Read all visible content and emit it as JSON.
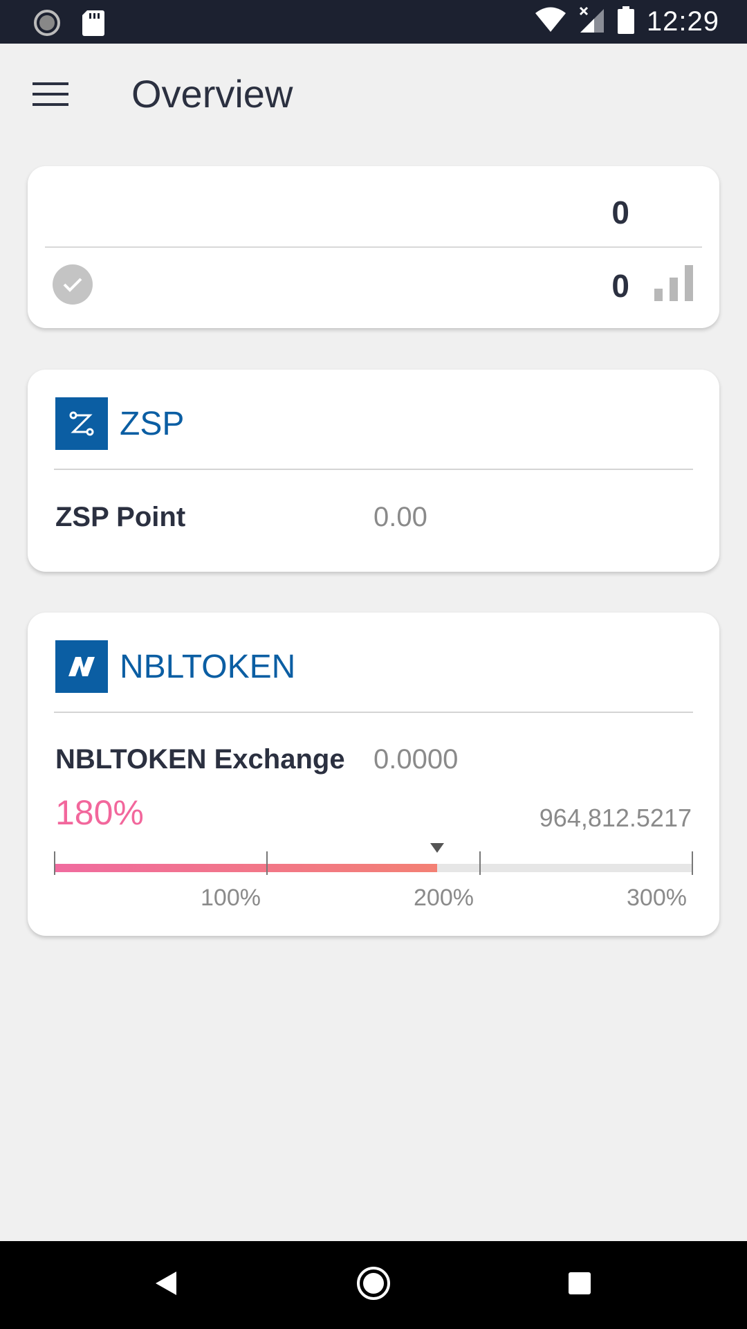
{
  "status_bar": {
    "time": "12:29",
    "icons": [
      "loading-circle-icon",
      "sd-card-icon",
      "wifi-icon",
      "no-signal-icon",
      "battery-icon"
    ]
  },
  "app_bar": {
    "title": "Overview",
    "menu_icon": "hamburger-menu-icon"
  },
  "summary": {
    "value1": "0",
    "value2": "0",
    "check_icon": "check-circle-icon",
    "chart_icon": "bar-chart-icon"
  },
  "zsp": {
    "name": "ZSP",
    "point_label": "ZSP Point",
    "point_value": "0.00"
  },
  "nbltoken": {
    "name": "NBLTOKEN",
    "exchange_label": "NBLTOKEN Exchange",
    "exchange_value": "0.0000",
    "percent": "180%",
    "limit": "964,812.5217",
    "gauge": {
      "level_percent": 180,
      "max_percent": 300,
      "labels": [
        "100%",
        "200%",
        "300%"
      ]
    }
  },
  "colors": {
    "brand_blue": "#0b5ea3",
    "accent_pink": "#f2679c",
    "statusbar": "#1c2130"
  }
}
